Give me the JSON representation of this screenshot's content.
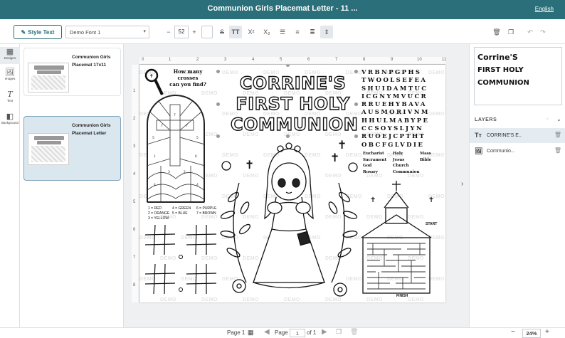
{
  "header": {
    "title": "Communion Girls Placemat Letter - 11 ...",
    "language": "English"
  },
  "toolbar": {
    "style_text_label": "Style Text",
    "font_name": "Demo Font 1",
    "font_size": "52",
    "minus": "−",
    "plus": "+",
    "strike": "S",
    "caps": "TT",
    "superscript": "X²",
    "subscript": "X₂"
  },
  "leftnav": {
    "items": [
      {
        "label": "Designs",
        "icon": "designs-icon"
      },
      {
        "label": "Images",
        "icon": "images-icon"
      },
      {
        "label": "Text",
        "icon": "text-icon"
      },
      {
        "label": "Background",
        "icon": "background-icon"
      }
    ]
  },
  "designs": [
    {
      "name": "Communion Girls Placemat 17x11"
    },
    {
      "name": "Communion Girls Placemat Letter"
    }
  ],
  "canvas": {
    "ruler_marks": [
      "0",
      "1",
      "2",
      "3",
      "4",
      "5",
      "6",
      "7",
      "8",
      "9",
      "10",
      "11"
    ],
    "ruler_left_marks": [
      "1",
      "2",
      "3",
      "4",
      "5",
      "6",
      "7",
      "8"
    ],
    "crosses_question": [
      "How many crosses",
      "can you find?"
    ],
    "title_lines": [
      "CORRINE'S",
      "FIRST HOLY",
      "COMMUNION"
    ],
    "demo_text": "DEMO",
    "color_legend": [
      "1 = RED",
      "2 = ORANGE",
      "3 = YELLOW",
      "4 = GREEN",
      "5 = BLUE",
      "6 = PURPLE",
      "7 = BROWN"
    ],
    "wordsearch_rows": [
      "VRBNPGPHS",
      "TWOOLSEFEA",
      "SHUIDAMTUC",
      "ICGNYMVUCR",
      "RRUEHYBAVA",
      "AUSMORIVNM",
      "HHULMABYPE",
      "CCSOYSLJYN",
      "RUOEJCPTHT",
      "OBCFGLVDIE"
    ],
    "wordlist": [
      [
        "Eucharist",
        "Sacrament",
        "God",
        "Rosary"
      ],
      [
        "Holy",
        "Jesus",
        "Church",
        "Communion"
      ],
      [
        "Mass",
        "Bible"
      ]
    ],
    "maze_start": "START",
    "maze_finish": "FINISH"
  },
  "right_panel": {
    "preview_lines": [
      "Corrine'S",
      "FIRST HOLY",
      "COMMUNION"
    ],
    "layers_title": "LAYERS",
    "layers": [
      {
        "name": "CORRINE'S E..",
        "icon": "text-layer-icon"
      },
      {
        "name": "Communio...",
        "icon": "image-layer-icon"
      }
    ]
  },
  "bottombar": {
    "page_label_left": "Page 1",
    "page_word": "Page",
    "page_value": "1",
    "of_label": "of 1",
    "zoom": "24%",
    "zoom_minus": "−",
    "zoom_plus": "+"
  }
}
